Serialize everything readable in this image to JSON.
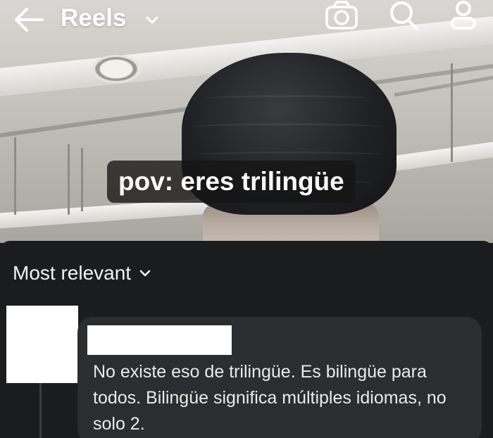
{
  "header": {
    "title": "Reels",
    "icons": [
      "back-arrow-icon",
      "chevron-down-icon",
      "camera-icon",
      "search-icon",
      "profile-icon"
    ]
  },
  "video": {
    "caption": "pov: eres trilingüe"
  },
  "comments": {
    "sort_label": "Most relevant",
    "items": [
      {
        "text": "No existe eso de trilingüe. Es bilingüe para todos. Bilingüe significa múltiples idiomas, no solo 2."
      }
    ]
  },
  "colors": {
    "sheet_background": "#1b1c1e",
    "bubble_background": "#2c2d30",
    "text": "#eaeaea",
    "caption_background": "#141414"
  }
}
